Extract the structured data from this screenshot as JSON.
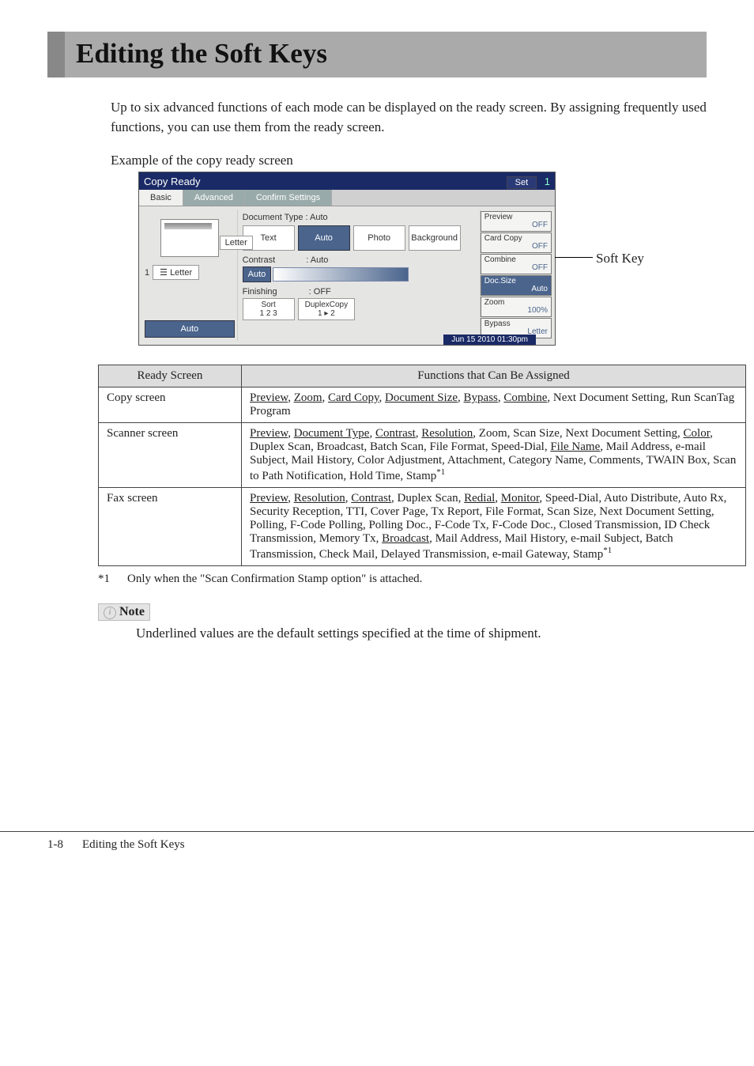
{
  "chapter_title": "Editing the Soft Keys",
  "intro_para": "Up to six advanced functions of each mode can be displayed on the ready screen. By assigning frequently used functions, you can use them from the ready screen.",
  "example_label": "Example of the copy ready screen",
  "screenshot": {
    "title": "Copy Ready",
    "set_label": "Set",
    "set_count": "1",
    "tabs": {
      "basic": "Basic",
      "advanced": "Advanced",
      "confirm": "Confirm Settings"
    },
    "left": {
      "letter_badge": "Letter",
      "tray_index": "1",
      "tray_icon": "☰",
      "tray_text": "Letter",
      "auto": "Auto"
    },
    "mid": {
      "doctype_label": "Document Type : Auto",
      "opts": {
        "text": "Text",
        "auto": "Auto",
        "photo": "Photo",
        "background": "Background"
      },
      "contrast_label": "Contrast",
      "contrast_value": ": Auto",
      "contrast_auto": "Auto",
      "finishing_label": "Finishing",
      "finishing_value": ": OFF",
      "sort": "Sort",
      "duplex": "DuplexCopy"
    },
    "softkeys": [
      {
        "name": "Preview",
        "value": "OFF",
        "sel": false
      },
      {
        "name": "Card Copy",
        "value": "OFF",
        "sel": false
      },
      {
        "name": "Combine",
        "value": "OFF",
        "sel": false
      },
      {
        "name": "Doc.Size",
        "value": "Auto",
        "sel": true
      },
      {
        "name": "Zoom",
        "value": "100%",
        "sel": false
      },
      {
        "name": "Bypass",
        "value": "Letter",
        "sel": false
      }
    ],
    "status": "Jun 15 2010 01:30pm"
  },
  "anno_softkey": "Soft Key",
  "table": {
    "head_ready": "Ready Screen",
    "head_func": "Functions that Can Be Assigned",
    "rows": {
      "copy": {
        "label": "Copy screen",
        "u": [
          "Preview",
          "Zoom",
          "Card Copy",
          "Document Size",
          "Bypass",
          "Combine"
        ],
        "tail": "Next Document Setting, Run ScanTag Program"
      },
      "scanner": {
        "label": "Scanner screen",
        "seg": {
          "p1a": "Preview",
          "p1b": "Document Type",
          "p1c": "Contrast",
          "p1d": "Resolution",
          "p1e": "Zoom, Scan Size, Next Document Setting,",
          "p2a": "Color",
          "p2b": "Duplex Scan, Broadcast, Batch Scan, File Format, Speed-Dial,",
          "p3a": "File Name",
          "p3b": "Mail Address, e-mail Subject, Mail History, Color Adjustment, Attachment, Category Name, Comments, TWAIN Box, Scan to Path Notification, Hold Time, Stamp",
          "sup": "*1"
        }
      },
      "fax": {
        "label": "Fax screen",
        "seg": {
          "a1": "Preview",
          "a2": "Resolution",
          "a3": "Contrast",
          "a4": "Duplex Scan,",
          "a5": "Redial",
          "a6": "Monitor",
          "b": "Speed-Dial, Auto Distribute, Auto Rx, Security Reception, TTI, Cover Page, Tx Report, File Format, Scan Size, Next Document Setting, Polling, F-Code Polling, Polling Doc., F-Code Tx, F-Code Doc., Closed Transmission, ID Check Transmission, Memory Tx,",
          "c1": "Broadcast",
          "c2": "Mail Address, Mail History, e-mail Subject, Batch Transmission, Check Mail, Delayed Transmission, e-mail Gateway, Stamp",
          "sup": "*1"
        }
      }
    }
  },
  "footnote": {
    "mark": "*1",
    "text": "Only when the \"Scan Confirmation Stamp option\" is attached."
  },
  "note": {
    "head": "Note",
    "body": "Underlined values are the default settings specified at the time of shipment."
  },
  "footer": {
    "page": "1-8",
    "section": "Editing the Soft Keys"
  }
}
